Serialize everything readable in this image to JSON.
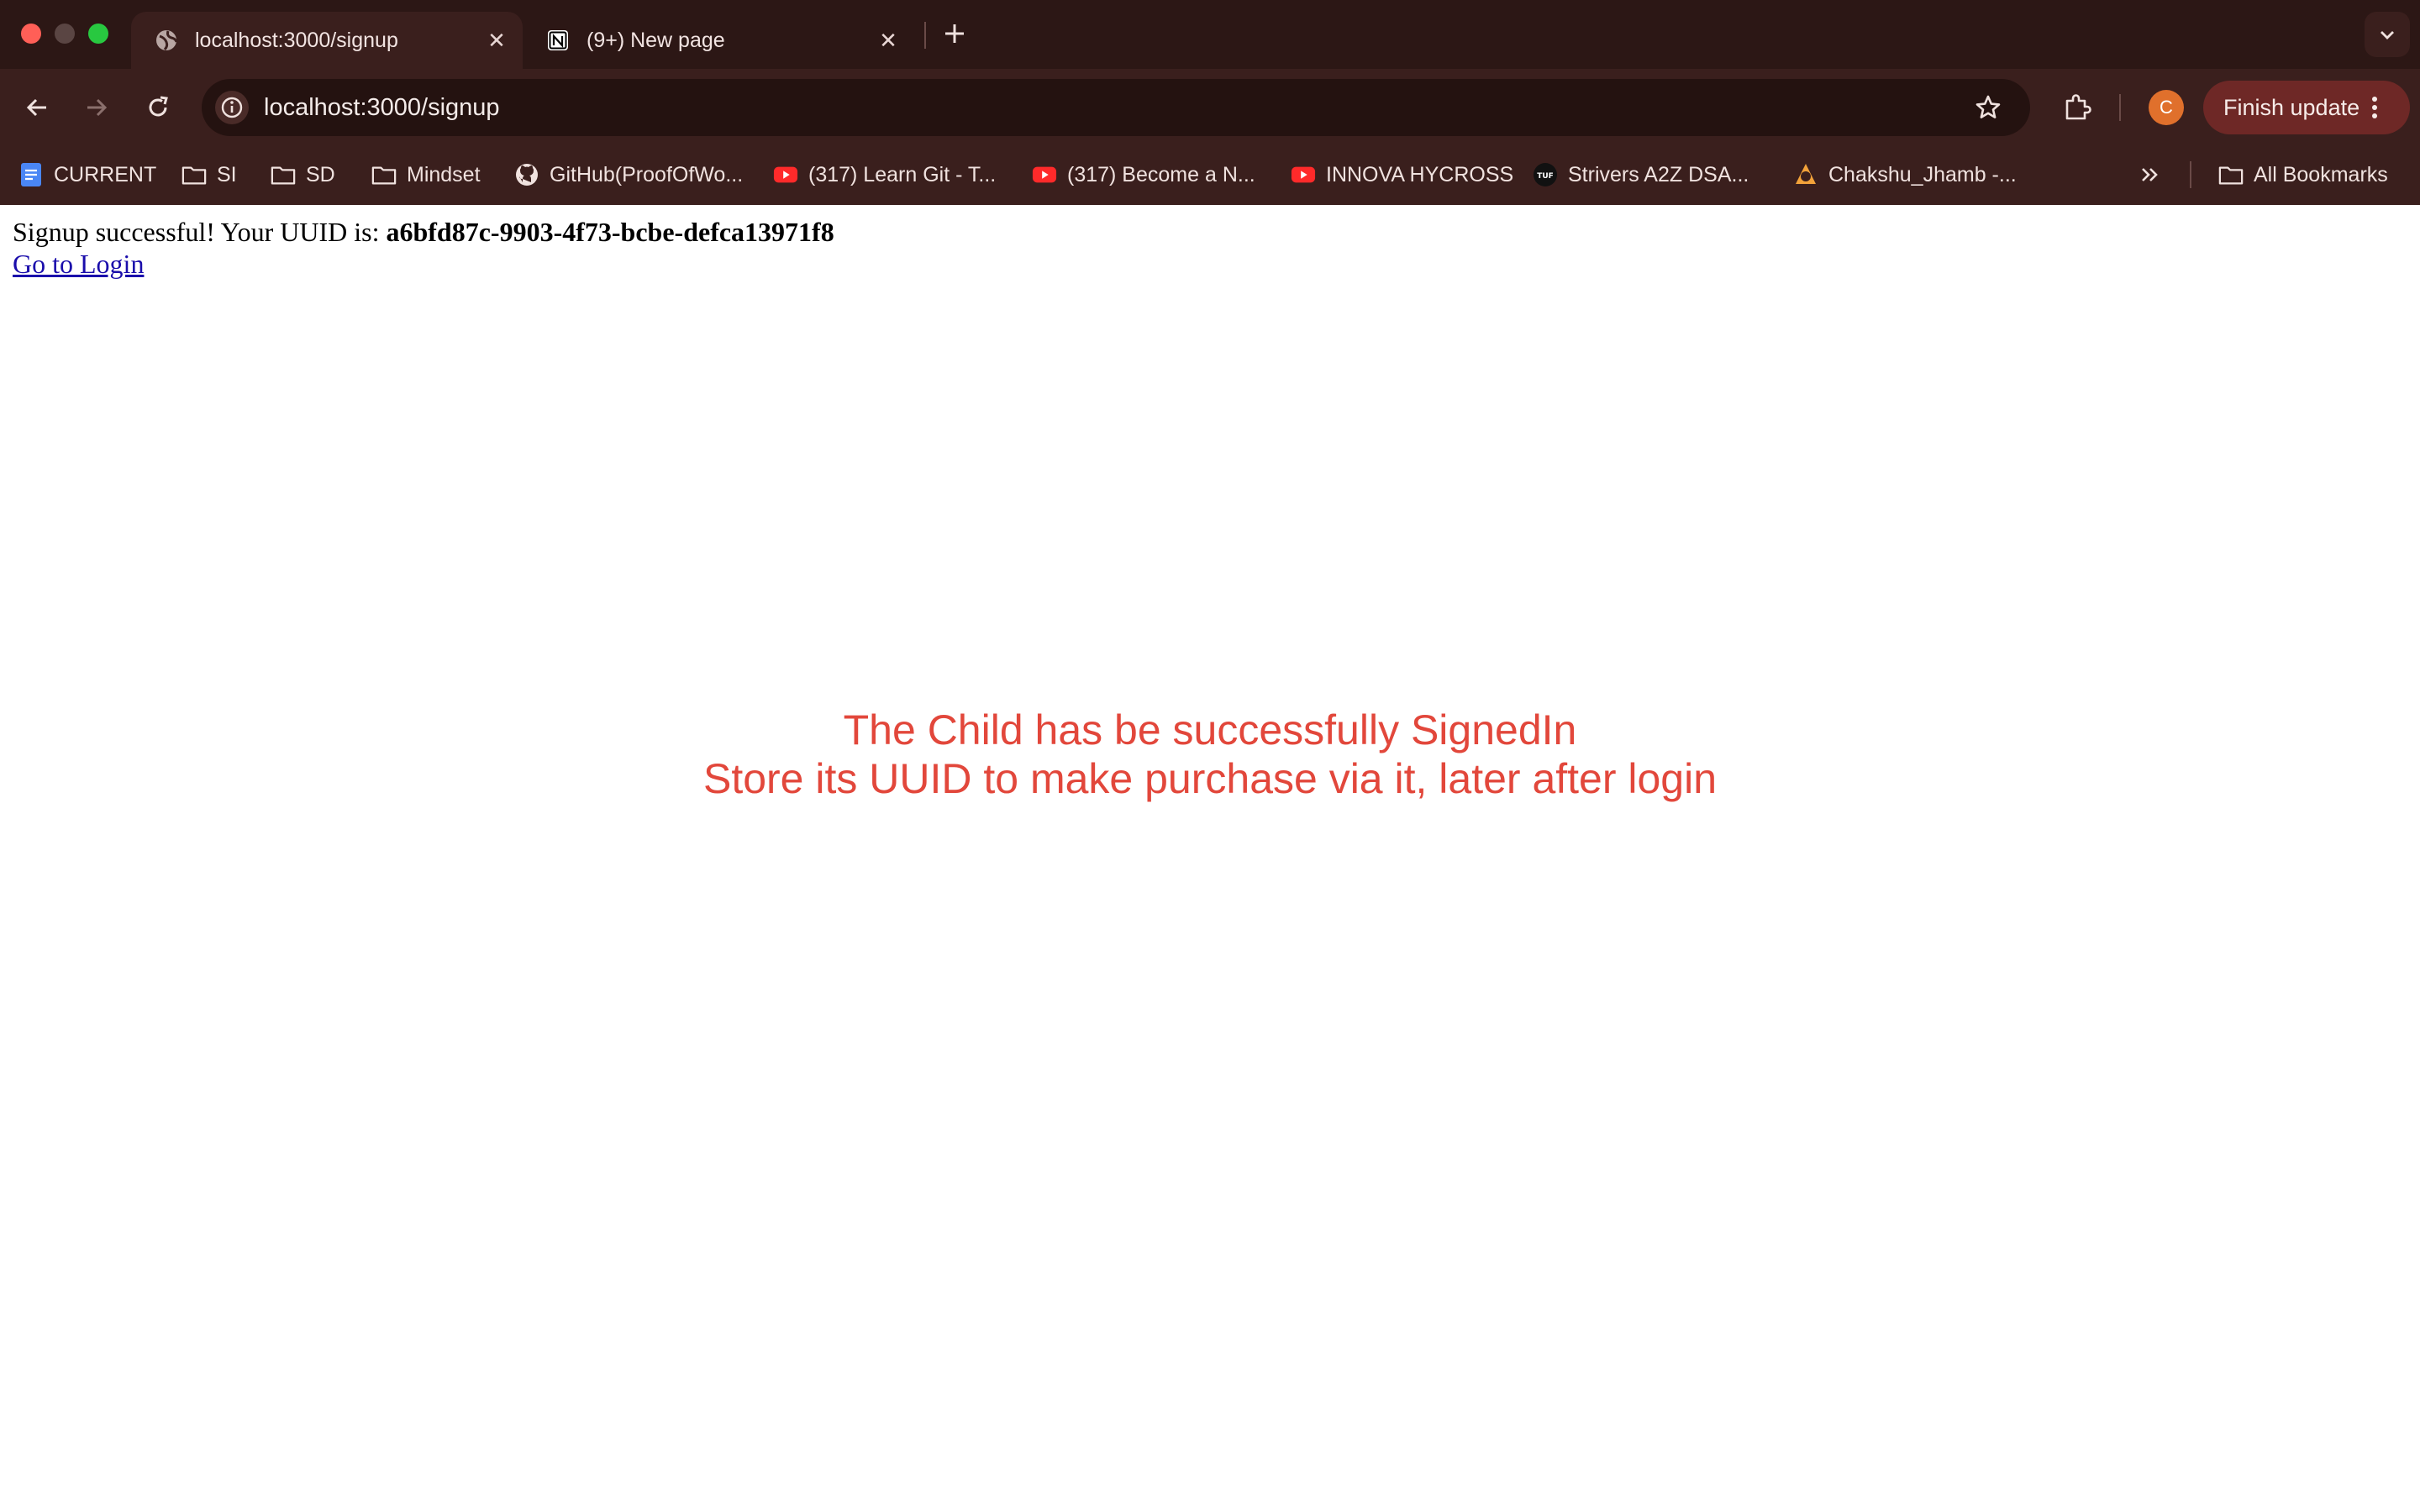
{
  "browser": {
    "tabs": [
      {
        "title": "localhost:3000/signup",
        "icon": "globe-icon",
        "active": true
      },
      {
        "title": "(9+) New page",
        "icon": "notion-icon",
        "active": false
      }
    ],
    "address_bar": {
      "url": "localhost:3000/signup"
    },
    "profile_initial": "C",
    "finish_update_label": "Finish update",
    "bookmarks": [
      {
        "label": "CURRENT",
        "icon": "google-docs-icon"
      },
      {
        "label": "SI",
        "icon": "folder-icon"
      },
      {
        "label": "SD",
        "icon": "folder-icon"
      },
      {
        "label": "Mindset",
        "icon": "folder-icon"
      },
      {
        "label": "GitHub(ProofOfWo...",
        "icon": "github-icon"
      },
      {
        "label": "(317) Learn Git - T...",
        "icon": "youtube-icon"
      },
      {
        "label": "(317) Become a N...",
        "icon": "youtube-icon"
      },
      {
        "label": "INNOVA HYCROSS",
        "icon": "youtube-icon"
      },
      {
        "label": "Strivers A2Z DSA...",
        "icon": "tuf-icon"
      },
      {
        "label": "Chakshu_Jhamb -...",
        "icon": "profile-site-icon"
      }
    ],
    "all_bookmarks_label": "All Bookmarks",
    "colors": {
      "tabstrip": "#2c1715",
      "toolbar": "#3a1f1d",
      "omnibox": "#241210",
      "finish_update_bg": "#6e2826",
      "profile_avatar": "#e0702c"
    }
  },
  "page": {
    "signup_prefix": "Signup successful! Your UUID is: ",
    "uuid": "a6bfd87c-9903-4f73-bcbe-defca13971f8",
    "login_link": "Go to Login",
    "banner_line1": "The Child has be successfully SignedIn",
    "banner_line2": "Store its UUID to make purchase via it, later after login",
    "banner_color": "#e2473b"
  }
}
